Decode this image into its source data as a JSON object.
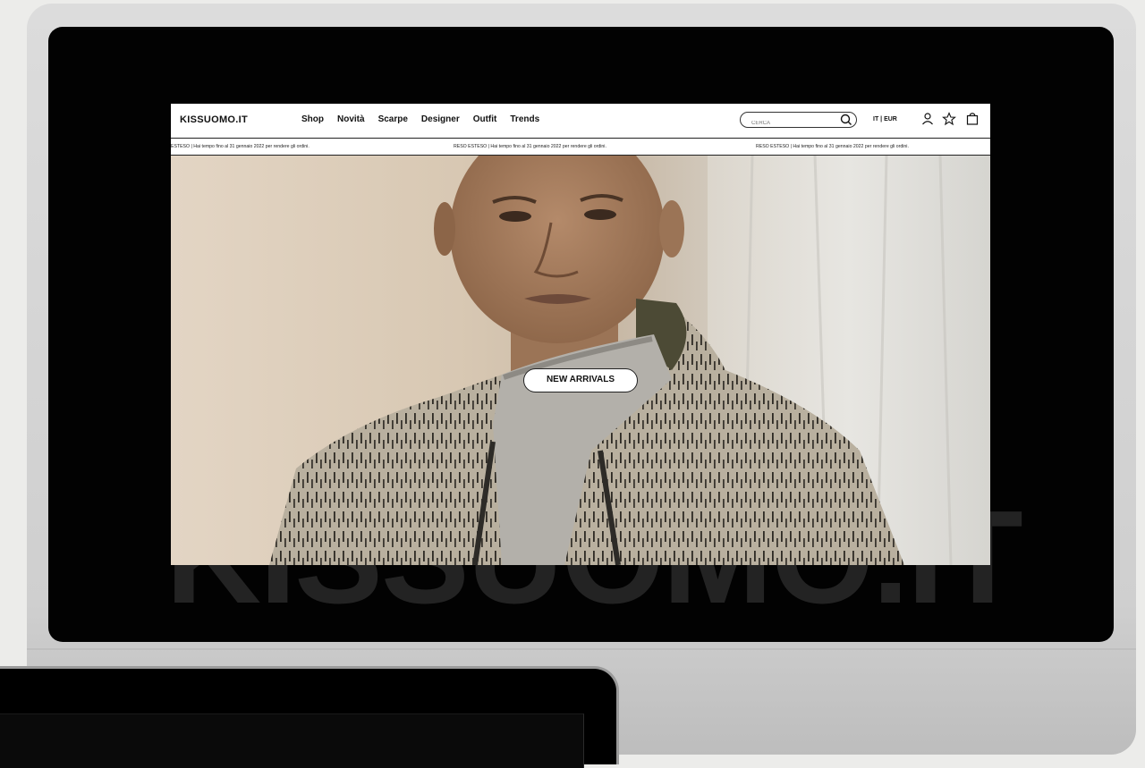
{
  "site": {
    "logo": "KISSUOMO.IT",
    "nav": [
      "Shop",
      "Novità",
      "Scarpe",
      "Designer",
      "Outfit",
      "Trends"
    ],
    "search_placeholder": "CERCA",
    "locale": "IT | EUR",
    "ticker_text": "RESO ESTESO | Hai tempo fino al 31 gennaio 2022 per rendere gli ordini.",
    "ticker_text_cut": "ESTESO | Hai tempo fino al 31 gennaio 2022 per rendere gli ordini.",
    "hero_cta": "NEW ARRIVALS"
  },
  "watermark": "KISSUOMO.IT",
  "icons": [
    "search-icon",
    "user-icon",
    "star-icon",
    "shopping-bag-icon"
  ],
  "colors": {
    "screen": "#020202",
    "frame": "#d6d6d6",
    "watermark": "#232323"
  }
}
